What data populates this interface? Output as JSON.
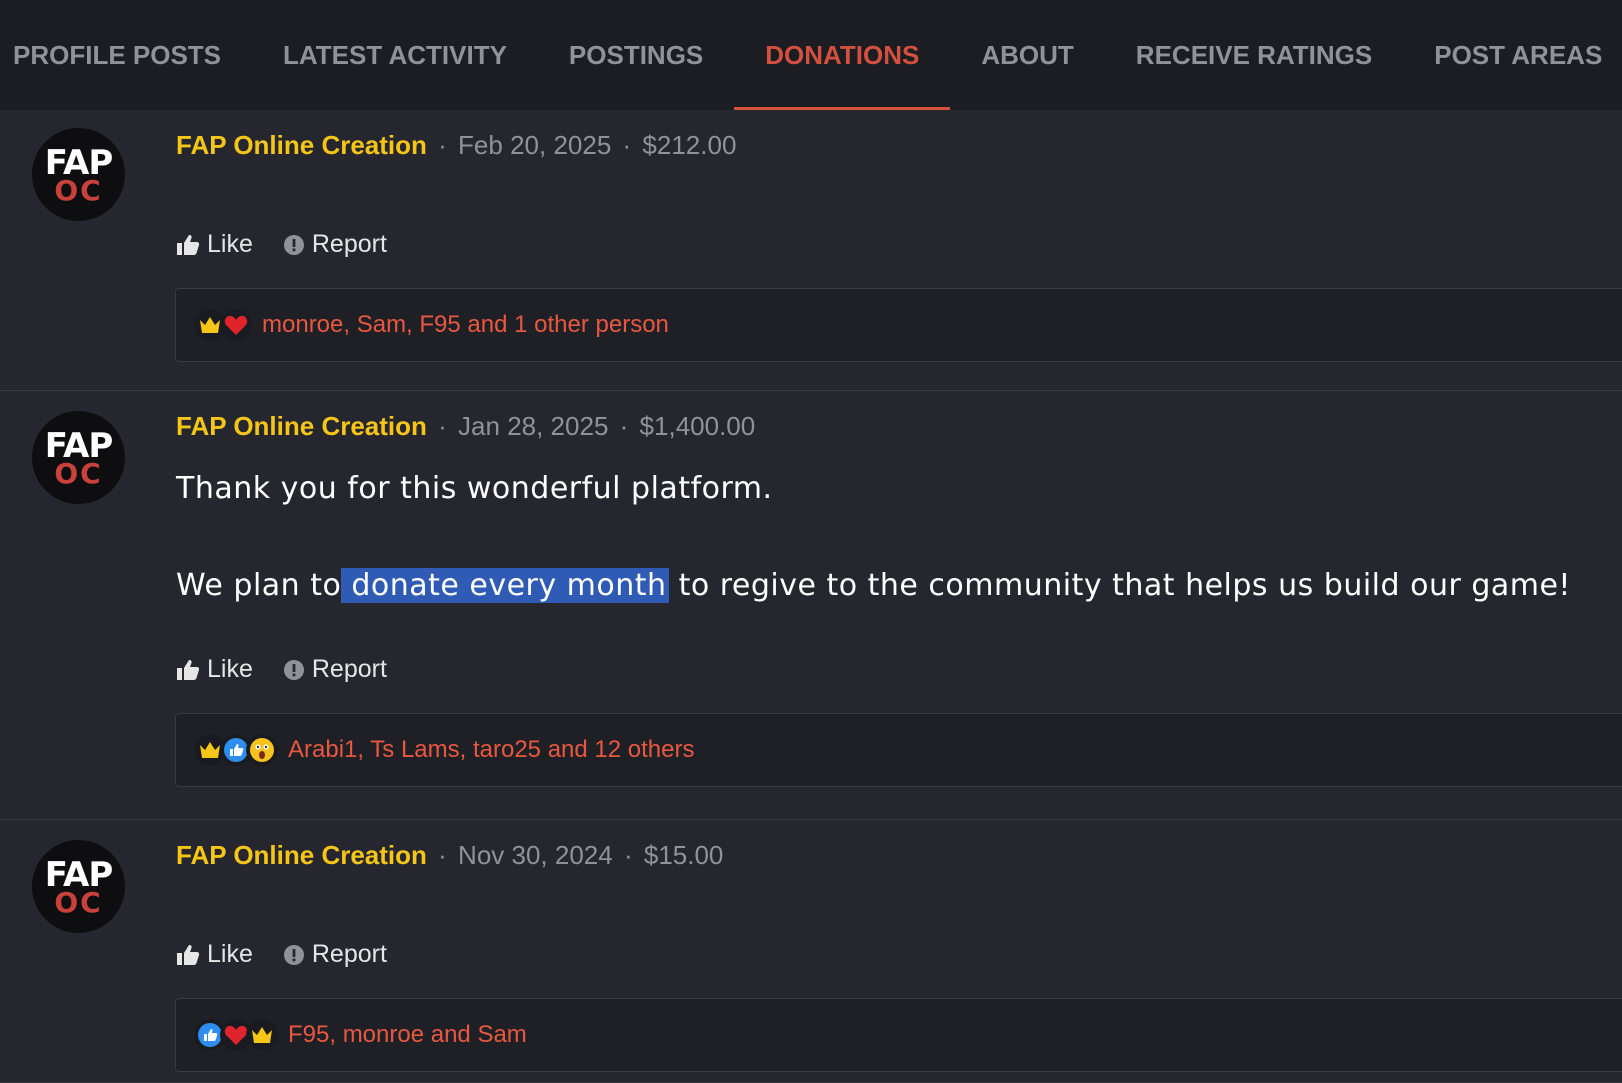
{
  "tabs": [
    {
      "label": "PROFILE POSTS"
    },
    {
      "label": "LATEST ACTIVITY"
    },
    {
      "label": "POSTINGS"
    },
    {
      "label": "DONATIONS"
    },
    {
      "label": "ABOUT"
    },
    {
      "label": "RECEIVE RATINGS"
    },
    {
      "label": "POST AREAS"
    }
  ],
  "active_tab": "DONATIONS",
  "colors": {
    "accent": "#d3503f",
    "author": "#f5c518",
    "reactions": "#e8573f",
    "selection": "#2f5bb5"
  },
  "avatar": {
    "top": "FAP",
    "bottom": "OC"
  },
  "actions": {
    "like": "Like",
    "report": "Report"
  },
  "posts": [
    {
      "author": "FAP Online Creation",
      "sep1": "·",
      "date": "Feb 20, 2025",
      "sep2": "·",
      "amount": "$212.00",
      "reactions_icons": [
        "crown-icon",
        "heart-icon"
      ],
      "reactions_text": "monroe, Sam, F95 and 1 other person"
    },
    {
      "author": "FAP Online Creation",
      "sep1": "·",
      "date": "Jan 28, 2025",
      "sep2": "·",
      "amount": "$1,400.00",
      "message_line1": "Thank you for this wonderful platform.",
      "message_line2_before": "We plan to",
      "message_line2_highlight": "donate every month",
      "message_line2_after": " to regive to the community that helps us build our game!",
      "reactions_icons": [
        "crown-icon",
        "thumbs-up-icon",
        "shocked-face-icon"
      ],
      "reactions_text": "Arabi1, Ts Lams, taro25 and 12 others"
    },
    {
      "author": "FAP Online Creation",
      "sep1": "·",
      "date": "Nov 30, 2024",
      "sep2": "·",
      "amount": "$15.00",
      "reactions_icons": [
        "thumbs-up-icon",
        "heart-icon",
        "crown-icon"
      ],
      "reactions_text": "F95, monroe and Sam"
    }
  ]
}
